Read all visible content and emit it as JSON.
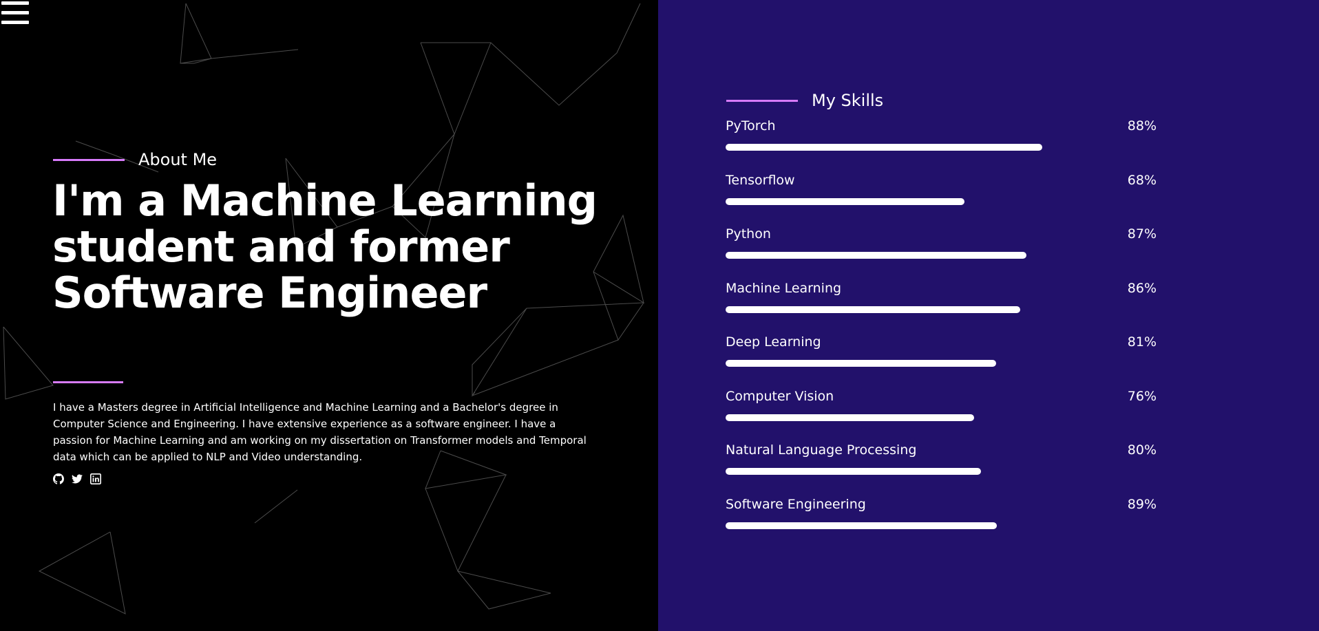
{
  "about": {
    "label": "About Me",
    "headline": "I'm a Machine Learning student and former Software Engineer",
    "bio": "I have a Masters degree in Artificial Intelligence and Machine Learning and a Bachelor's degree in Computer Science and Engineering. I have extensive experience as a software engineer. I have a passion for Machine Learning and am working on my dissertation on Transformer models and Temporal data which can be applied to NLP and Video understanding.",
    "socials": [
      {
        "icon": "github-icon"
      },
      {
        "icon": "twitter-icon"
      },
      {
        "icon": "linkedin-icon"
      }
    ]
  },
  "skills": {
    "title": "My Skills",
    "items": [
      {
        "name": "PyTorch",
        "percent_label": "88%",
        "bar_fill": 0.735
      },
      {
        "name": "Tensorflow",
        "percent_label": "68%",
        "bar_fill": 0.555
      },
      {
        "name": "Python",
        "percent_label": "87%",
        "bar_fill": 0.698
      },
      {
        "name": "Machine Learning",
        "percent_label": "86%",
        "bar_fill": 0.684
      },
      {
        "name": "Deep Learning",
        "percent_label": "81%",
        "bar_fill": 0.628
      },
      {
        "name": "Computer Vision",
        "percent_label": "76%",
        "bar_fill": 0.577
      },
      {
        "name": "Natural Language Processing",
        "percent_label": "80%",
        "bar_fill": 0.593
      },
      {
        "name": "Software Engineering",
        "percent_label": "89%",
        "bar_fill": 0.63
      }
    ]
  },
  "colors": {
    "accent": "#d77bfa",
    "skills_background": "#22116b",
    "left_background": "#000000"
  }
}
